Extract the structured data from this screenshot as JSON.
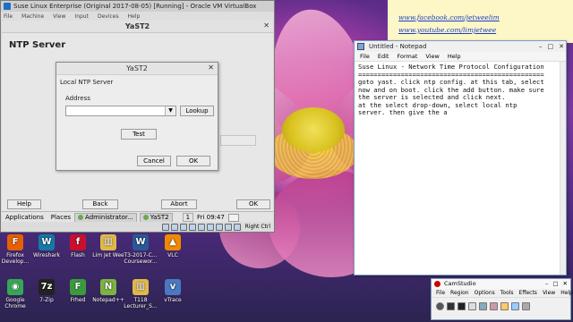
{
  "vbox": {
    "title": "Suse Linux Enterprise (Original 2017-08-05) [Running] - Oracle VM VirtualBox",
    "menu": [
      "File",
      "Machine",
      "View",
      "Input",
      "Devices",
      "Help"
    ],
    "hostkey": "Right Ctrl"
  },
  "yast": {
    "title": "YaST2",
    "heading": "NTP Server",
    "buttons": {
      "help": "Help",
      "back": "Back",
      "abort": "Abort",
      "ok": "OK"
    }
  },
  "dialog": {
    "title": "YaST2",
    "section": "Local NTP Server",
    "address_label": "Address",
    "address_value": "",
    "lookup": "Lookup",
    "test": "Test",
    "cancel": "Cancel",
    "ok": "OK"
  },
  "gnome_panel": {
    "applications": "Applications",
    "places": "Places",
    "tasks": [
      "Administrator...",
      "YaST2"
    ],
    "workspace": "1",
    "clock": "Fri 09:47"
  },
  "notepad": {
    "title": "Untitled - Notepad",
    "menu": [
      "File",
      "Edit",
      "Format",
      "View",
      "Help"
    ],
    "lines": [
      "Suse Linux - Network Time Protocol Configuration",
      "================================================",
      "",
      "goto yast. click ntp config. at this tab, select",
      "now and on boot. click the add button. make sure",
      "the server is selected and click next.",
      "",
      "at the select drop-down, select local ntp",
      "server. then give the a"
    ]
  },
  "sticky": {
    "links": [
      "www.facebook.com/jetweelim",
      "www.youtube.com/limjetwee"
    ]
  },
  "desktop_icons": [
    {
      "label": "Firefox Develop...",
      "icon": "firefox-icon",
      "color": "#e66000",
      "glyph": "F"
    },
    {
      "label": "Wireshark",
      "icon": "wireshark-icon",
      "color": "#1679a7",
      "glyph": "W"
    },
    {
      "label": "Flash",
      "icon": "flash-icon",
      "color": "#c8102e",
      "glyph": "f"
    },
    {
      "label": "Lim Jet Wee",
      "icon": "folder-icon",
      "color": "#e0b84a",
      "glyph": "▥"
    },
    {
      "label": "T3-2017-C... Coursewor...",
      "icon": "word-doc-icon",
      "color": "#2b579a",
      "glyph": "W"
    },
    {
      "label": "VLC",
      "icon": "vlc-icon",
      "color": "#f08a00",
      "glyph": "▲"
    },
    {
      "label": "Google Chrome",
      "icon": "chrome-icon",
      "color": "#34a853",
      "glyph": "◉"
    },
    {
      "label": "7-Zip",
      "icon": "7zip-icon",
      "color": "#222222",
      "glyph": "7z"
    },
    {
      "label": "Frhed",
      "icon": "frhed-icon",
      "color": "#3c9a3c",
      "glyph": "F"
    },
    {
      "label": "Notepad++",
      "icon": "notepadpp-icon",
      "color": "#7cb342",
      "glyph": "N"
    },
    {
      "label": "T118 Lecturer_S...",
      "icon": "folder-icon",
      "color": "#e0b84a",
      "glyph": "▥"
    },
    {
      "label": "vTrace",
      "icon": "vtrace-icon",
      "color": "#4a78c2",
      "glyph": "v"
    }
  ],
  "camstudio": {
    "title": "CamStudio",
    "menu": [
      "File",
      "Region",
      "Options",
      "Tools",
      "Effects",
      "View",
      "Help"
    ]
  }
}
